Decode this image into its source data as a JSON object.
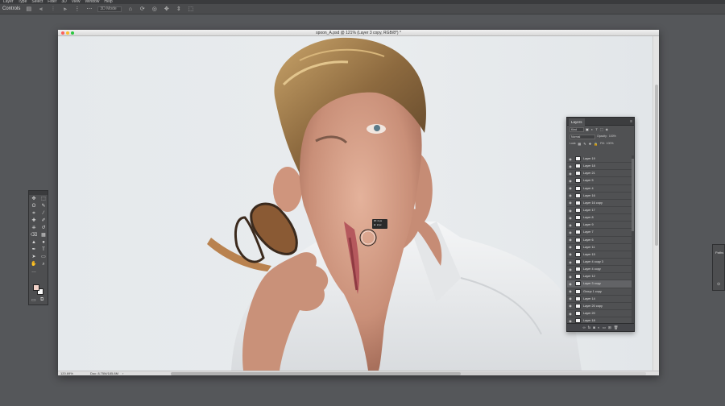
{
  "menubar": {
    "items": [
      "Layer",
      "Type",
      "Select",
      "Filter",
      "3D",
      "View",
      "Window",
      "Help"
    ]
  },
  "optionsbar": {
    "tool_label": "Controls",
    "field_value": "3D Mode",
    "icons": [
      "home-icon",
      "rotate-icon",
      "roll-icon",
      "pan-icon",
      "slide-icon",
      "scale-icon"
    ]
  },
  "document": {
    "title": "spoon_A.psd @ 121% (Layer 3 copy, RGB/8*) *",
    "zoom": "120.69%",
    "doc_size": "Doc: 8.75M/185.8M"
  },
  "tools": {
    "items": [
      "move",
      "marquee",
      "lasso",
      "quick-select",
      "crop",
      "eyedropper",
      "healing",
      "brush",
      "stamp",
      "history-brush",
      "eraser",
      "gradient",
      "blur",
      "dodge",
      "pen",
      "type",
      "path-select",
      "rectangle",
      "hand",
      "zoom",
      "more",
      "more"
    ],
    "glyphs": [
      "✥",
      "⬚",
      "ʘ",
      "✎",
      "⌗",
      "⁄",
      "✚",
      "✐",
      "⎈",
      "↺",
      "⌫",
      "▦",
      "▲",
      "●",
      "✒",
      "T",
      "➤",
      "▭",
      "✋",
      "⌕",
      "…",
      ""
    ],
    "colors": {
      "foreground": "#f3d3c9",
      "background": "#fbfbfb"
    }
  },
  "layers_panel": {
    "tab": "Layers",
    "filter_kind": "Kind",
    "blend_mode": "Normal",
    "opacity_label": "Opacity:",
    "opacity_value": "100%",
    "lock_label": "Lock:",
    "fill_label": "Fill:",
    "fill_value": "100%",
    "layers": [
      {
        "name": "Layer 19",
        "active": false
      },
      {
        "name": "Layer 18",
        "active": false
      },
      {
        "name": "Layer 21",
        "active": false
      },
      {
        "name": "Layer 5",
        "active": false
      },
      {
        "name": "Layer 4",
        "active": false
      },
      {
        "name": "Layer 16",
        "active": false
      },
      {
        "name": "Layer 16 copy",
        "active": false
      },
      {
        "name": "Layer 17",
        "active": false
      },
      {
        "name": "Layer 8",
        "active": false
      },
      {
        "name": "Layer 9",
        "active": false
      },
      {
        "name": "Layer 7",
        "active": false
      },
      {
        "name": "Layer 6",
        "active": false
      },
      {
        "name": "Layer 11",
        "active": false
      },
      {
        "name": "Layer 15",
        "active": false
      },
      {
        "name": "Layer 4 copy 3",
        "active": false
      },
      {
        "name": "Layer 4 copy",
        "active": false
      },
      {
        "name": "Layer 12",
        "active": false
      },
      {
        "name": "Layer 3 copy",
        "active": true
      },
      {
        "name": "Group 1 copy",
        "active": false
      },
      {
        "name": "Layer 14",
        "active": false
      },
      {
        "name": "Layer 20 copy",
        "active": false
      },
      {
        "name": "Layer 20",
        "active": false
      },
      {
        "name": "Layer 18",
        "active": false
      }
    ]
  },
  "paths_panel": {
    "label": "Paths"
  },
  "cursor_readout": {
    "line1": "W: 2 px",
    "line2": "H: 2 px"
  }
}
